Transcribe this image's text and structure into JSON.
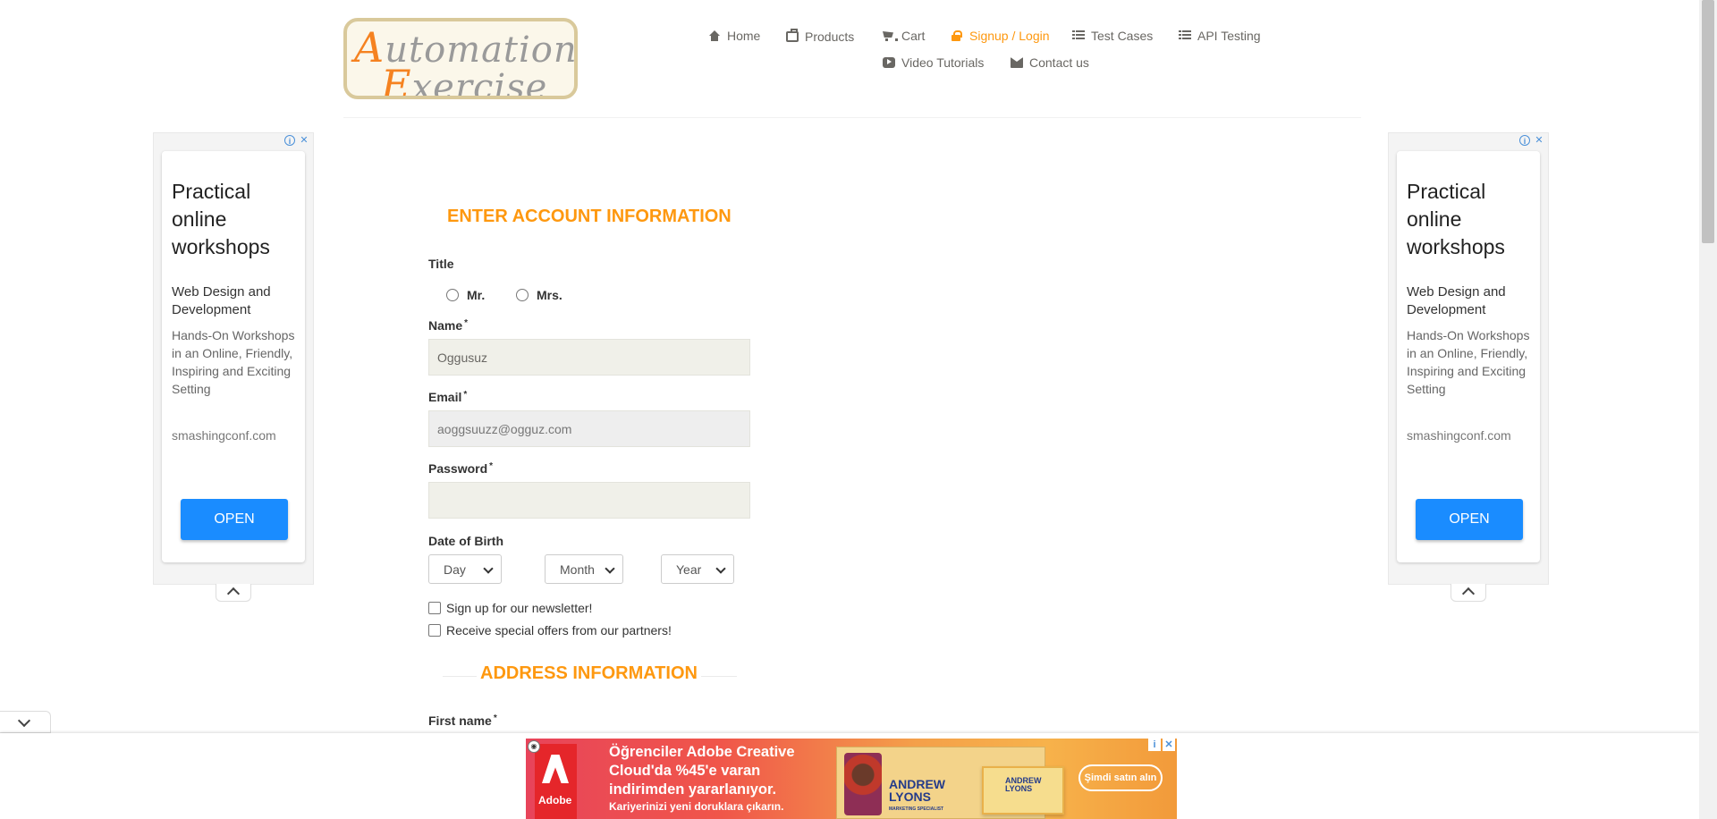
{
  "header": {
    "logo": {
      "line1": "Automation",
      "line2": "Exercise"
    },
    "nav": [
      {
        "label": "Home",
        "icon": "home-icon"
      },
      {
        "label": "Products",
        "icon": "box-icon"
      },
      {
        "label": "Cart",
        "icon": "cart-icon"
      },
      {
        "label": "Signup / Login",
        "icon": "lock-icon",
        "active": true
      },
      {
        "label": "Test Cases",
        "icon": "list-icon"
      },
      {
        "label": "API Testing",
        "icon": "list-icon"
      },
      {
        "label": "Video Tutorials",
        "icon": "youtube-icon"
      },
      {
        "label": "Contact us",
        "icon": "envelope-icon"
      }
    ]
  },
  "side_ads": {
    "headline": "Practical online workshops",
    "sub": "Web Design and Development",
    "body": "Hands-On Workshops in an Online, Friendly, Inspiring and Exciting Setting",
    "url": "smashingconf.com",
    "button": "OPEN",
    "info_icon": "i",
    "close_icon": "✕"
  },
  "form": {
    "title": "ENTER ACCOUNT INFORMATION",
    "title_label": "Title",
    "title_options": [
      "Mr.",
      "Mrs."
    ],
    "name_label": "Name",
    "name_value": "Oggusuz",
    "email_label": "Email",
    "email_value": "aoggsuuzz@ogguz.com",
    "password_label": "Password",
    "password_value": "",
    "required_mark": "*",
    "dob_label": "Date of Birth",
    "dob_day": "Day",
    "dob_month": "Month",
    "dob_year": "Year",
    "newsletter_label": "Sign up for our newsletter!",
    "offers_label": "Receive special offers from our partners!",
    "address_title": "ADDRESS INFORMATION",
    "first_name_label": "First name"
  },
  "bottom_ad": {
    "brand": "Adobe",
    "headline": "Öğrenciler Adobe Creative Cloud'da %45'e varan indirimden yararlanıyor.",
    "sub": "Kariyerinizi yeni doruklara çıkarın.",
    "book_name_1": "ANDREW",
    "book_name_2": "LYONS",
    "book_role": "MARKETING SPECIALIST",
    "button": "Şimdi satın alın",
    "info_icon": "i",
    "close_icon": "✕"
  },
  "colors": {
    "accent": "#fe980f",
    "nav_text": "#696763",
    "input_bg": "#f0f0e9",
    "ad_button": "#1a8cff"
  }
}
